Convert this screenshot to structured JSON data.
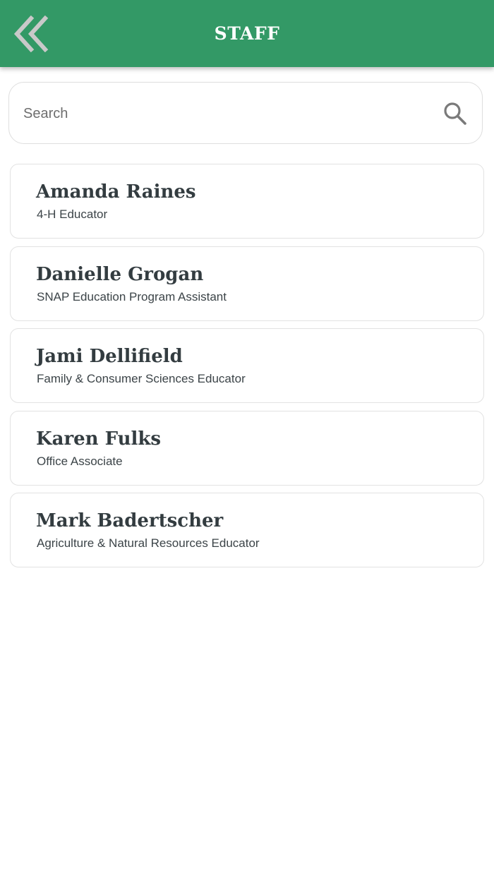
{
  "header": {
    "title": "STAFF",
    "back_icon": "double-chevron-left-icon",
    "color": "#339966"
  },
  "search": {
    "placeholder": "Search",
    "value": "",
    "icon": "search-icon"
  },
  "staff": [
    {
      "name": "Amanda Raines",
      "role": "4-H Educator"
    },
    {
      "name": "Danielle Grogan",
      "role": "SNAP Education Program Assistant"
    },
    {
      "name": "Jami Dellifield",
      "role": "Family & Consumer Sciences Educator"
    },
    {
      "name": "Karen Fulks",
      "role": "Office Associate"
    },
    {
      "name": "Mark Badertscher",
      "role": "Agriculture & Natural Resources Educator"
    }
  ]
}
